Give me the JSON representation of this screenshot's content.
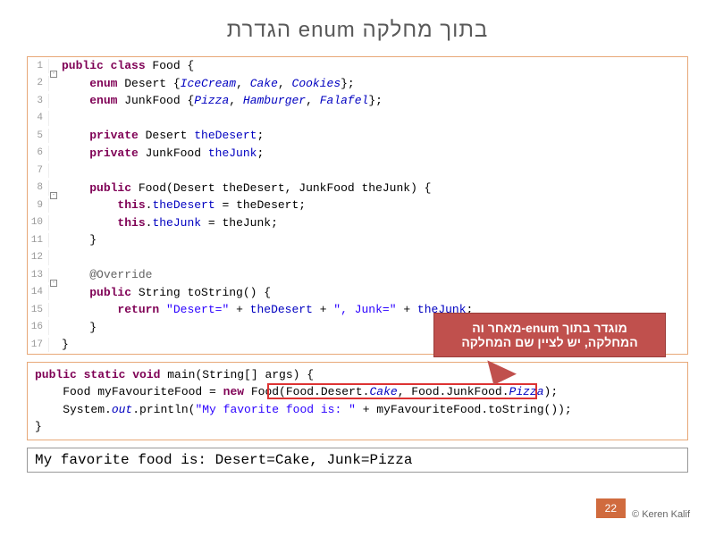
{
  "title": "הגדרת enum בתוך מחלקה",
  "code1": {
    "lines": [
      {
        "n": "1",
        "fold": true,
        "tokens": [
          [
            "kw",
            "public class"
          ],
          [
            "typ",
            " Food {"
          ]
        ]
      },
      {
        "n": "2",
        "fold": false,
        "tokens": [
          [
            "typ",
            "    "
          ],
          [
            "kw",
            "enum"
          ],
          [
            "typ",
            " Desert {"
          ],
          [
            "lit",
            "IceCream"
          ],
          [
            "typ",
            ", "
          ],
          [
            "lit",
            "Cake"
          ],
          [
            "typ",
            ", "
          ],
          [
            "lit",
            "Cookies"
          ],
          [
            "typ",
            "};"
          ]
        ]
      },
      {
        "n": "3",
        "fold": false,
        "tokens": [
          [
            "typ",
            "    "
          ],
          [
            "kw",
            "enum"
          ],
          [
            "typ",
            " JunkFood {"
          ],
          [
            "lit",
            "Pizza"
          ],
          [
            "typ",
            ", "
          ],
          [
            "lit",
            "Hamburger"
          ],
          [
            "typ",
            ", "
          ],
          [
            "lit",
            "Falafel"
          ],
          [
            "typ",
            "};"
          ]
        ]
      },
      {
        "n": "4",
        "fold": false,
        "tokens": [
          [
            "typ",
            " "
          ]
        ]
      },
      {
        "n": "5",
        "fold": false,
        "tokens": [
          [
            "typ",
            "    "
          ],
          [
            "kw",
            "private"
          ],
          [
            "typ",
            " Desert "
          ],
          [
            "fld",
            "theDesert"
          ],
          [
            "typ",
            ";"
          ]
        ]
      },
      {
        "n": "6",
        "fold": false,
        "tokens": [
          [
            "typ",
            "    "
          ],
          [
            "kw",
            "private"
          ],
          [
            "typ",
            " JunkFood "
          ],
          [
            "fld",
            "theJunk"
          ],
          [
            "typ",
            ";"
          ]
        ]
      },
      {
        "n": "7",
        "fold": false,
        "tokens": [
          [
            "typ",
            " "
          ]
        ]
      },
      {
        "n": "8",
        "fold": true,
        "tokens": [
          [
            "typ",
            "    "
          ],
          [
            "kw",
            "public"
          ],
          [
            "typ",
            " Food(Desert theDesert, JunkFood theJunk) {"
          ]
        ]
      },
      {
        "n": "9",
        "fold": false,
        "tokens": [
          [
            "typ",
            "        "
          ],
          [
            "kw",
            "this"
          ],
          [
            "typ",
            "."
          ],
          [
            "fld",
            "theDesert"
          ],
          [
            "typ",
            " = theDesert;"
          ]
        ]
      },
      {
        "n": "10",
        "fold": false,
        "tokens": [
          [
            "typ",
            "        "
          ],
          [
            "kw",
            "this"
          ],
          [
            "typ",
            "."
          ],
          [
            "fld",
            "theJunk"
          ],
          [
            "typ",
            " = theJunk;"
          ]
        ]
      },
      {
        "n": "11",
        "fold": false,
        "tokens": [
          [
            "typ",
            "    }"
          ]
        ]
      },
      {
        "n": "12",
        "fold": false,
        "tokens": [
          [
            "typ",
            " "
          ]
        ]
      },
      {
        "n": "13",
        "fold": true,
        "tokens": [
          [
            "typ",
            "    "
          ],
          [
            "com",
            "@Override"
          ]
        ]
      },
      {
        "n": "14",
        "fold": false,
        "tokens": [
          [
            "typ",
            "    "
          ],
          [
            "kw",
            "public"
          ],
          [
            "typ",
            " String toString() {"
          ]
        ]
      },
      {
        "n": "15",
        "fold": false,
        "tokens": [
          [
            "typ",
            "        "
          ],
          [
            "kw",
            "return"
          ],
          [
            "typ",
            " "
          ],
          [
            "str",
            "\"Desert=\""
          ],
          [
            "typ",
            " + "
          ],
          [
            "fld",
            "theDesert"
          ],
          [
            "typ",
            " + "
          ],
          [
            "str",
            "\", Junk=\""
          ],
          [
            "typ",
            " + "
          ],
          [
            "fld",
            "theJunk"
          ],
          [
            "typ",
            ";"
          ]
        ]
      },
      {
        "n": "16",
        "fold": false,
        "tokens": [
          [
            "typ",
            "    }"
          ]
        ]
      },
      {
        "n": "17",
        "fold": false,
        "tokens": [
          [
            "typ",
            "}"
          ]
        ]
      }
    ]
  },
  "code2": {
    "lines": [
      [
        [
          "kw",
          "public static void"
        ],
        [
          "typ",
          " main(String[] args) {"
        ]
      ],
      [
        [
          "typ",
          "    Food myFavouriteFood = "
        ],
        [
          "kw",
          "new"
        ],
        [
          "typ",
          " Food(Food.Desert."
        ],
        [
          "lit",
          "Cake"
        ],
        [
          "typ",
          ", Food.JunkFood."
        ],
        [
          "lit",
          "Pizza"
        ],
        [
          "typ",
          ");"
        ]
      ],
      [
        [
          "typ",
          "    System."
        ],
        [
          "lit",
          "out"
        ],
        [
          "typ",
          ".println("
        ],
        [
          "str",
          "\"My favorite food is: \""
        ],
        [
          "typ",
          " + myFavouriteFood.toString());"
        ]
      ],
      [
        [
          "typ",
          "}"
        ]
      ]
    ]
  },
  "output": "My favorite food is: Desert=Cake, Junk=Pizza",
  "callout_text": "מאחר וה-enum מוגדר בתוך המחלקה,  יש לציין שם המחלקה",
  "page_number": "22",
  "copyright": "© Keren Kalif"
}
